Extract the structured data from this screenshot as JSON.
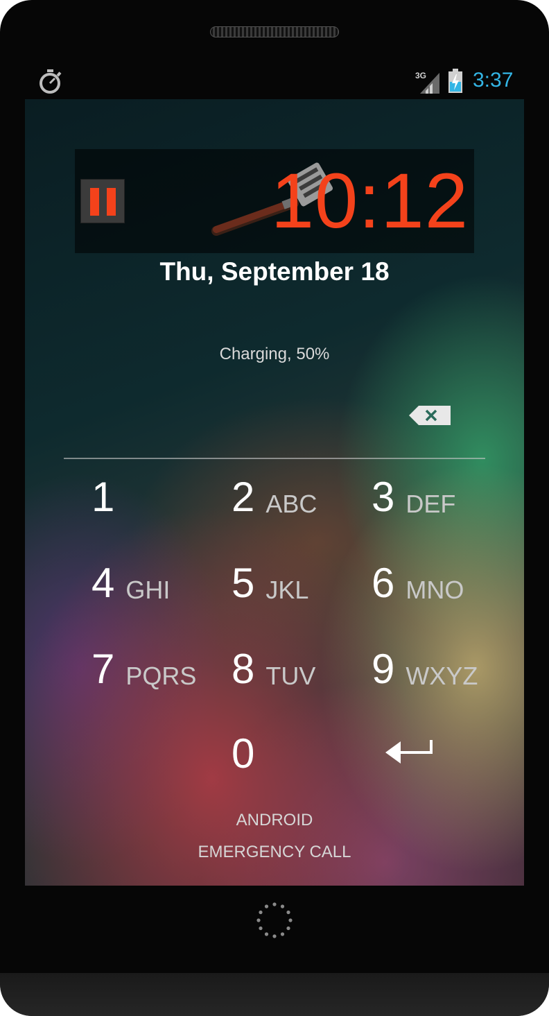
{
  "status_bar": {
    "time": "3:37",
    "network": "3G",
    "icons": [
      "stopwatch-icon",
      "signal-icon",
      "battery-charging-icon"
    ],
    "time_color": "#33b5e5"
  },
  "lockscreen": {
    "widget": {
      "time": "10:12",
      "accent_color": "#f4421b",
      "icons": [
        "pause-icon",
        "spatula-icon"
      ]
    },
    "date": "Thu, September 18",
    "charging": "Charging, 50%",
    "keypad": [
      {
        "num": "1",
        "letters": ""
      },
      {
        "num": "2",
        "letters": "ABC"
      },
      {
        "num": "3",
        "letters": "DEF"
      },
      {
        "num": "4",
        "letters": "GHI"
      },
      {
        "num": "5",
        "letters": "JKL"
      },
      {
        "num": "6",
        "letters": "MNO"
      },
      {
        "num": "7",
        "letters": "PQRS"
      },
      {
        "num": "8",
        "letters": "TUV"
      },
      {
        "num": "9",
        "letters": "WXYZ"
      },
      {
        "num": "0",
        "letters": ""
      }
    ],
    "carrier": "ANDROID",
    "emergency": "EMERGENCY CALL"
  }
}
